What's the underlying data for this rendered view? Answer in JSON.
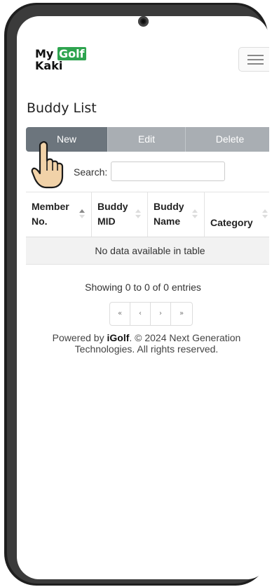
{
  "header": {
    "logo_line1": "My",
    "logo_golf": "Golf",
    "logo_line2": "Kaki"
  },
  "page": {
    "title": "Buddy List"
  },
  "actions": {
    "new_label": "New",
    "edit_label": "Edit",
    "delete_label": "Delete"
  },
  "search": {
    "label": "Search:",
    "value": ""
  },
  "table": {
    "columns": [
      {
        "line1": "Member",
        "line2": "No."
      },
      {
        "line1": "Buddy",
        "line2": "MID"
      },
      {
        "line1": "Buddy",
        "line2": "Name"
      },
      {
        "line1": "Category"
      }
    ],
    "empty_message": "No data available in table"
  },
  "info": {
    "text": "Showing 0 to 0 of 0 entries"
  },
  "pagination": {
    "first": "«",
    "prev": "‹",
    "next": "›",
    "last": "»"
  },
  "footer": {
    "prefix": "Powered by ",
    "brand": "iGolf",
    "suffix": ". © 2024 Next Generation Technologies. All rights reserved."
  },
  "icons": {
    "menu": "hamburger-icon",
    "pointer": "pointing-hand-icon",
    "camera": "camera-icon"
  },
  "colors": {
    "brand_green": "#2ea44f",
    "button_active": "#6c757d",
    "button_inactive": "#a9aeb3"
  }
}
